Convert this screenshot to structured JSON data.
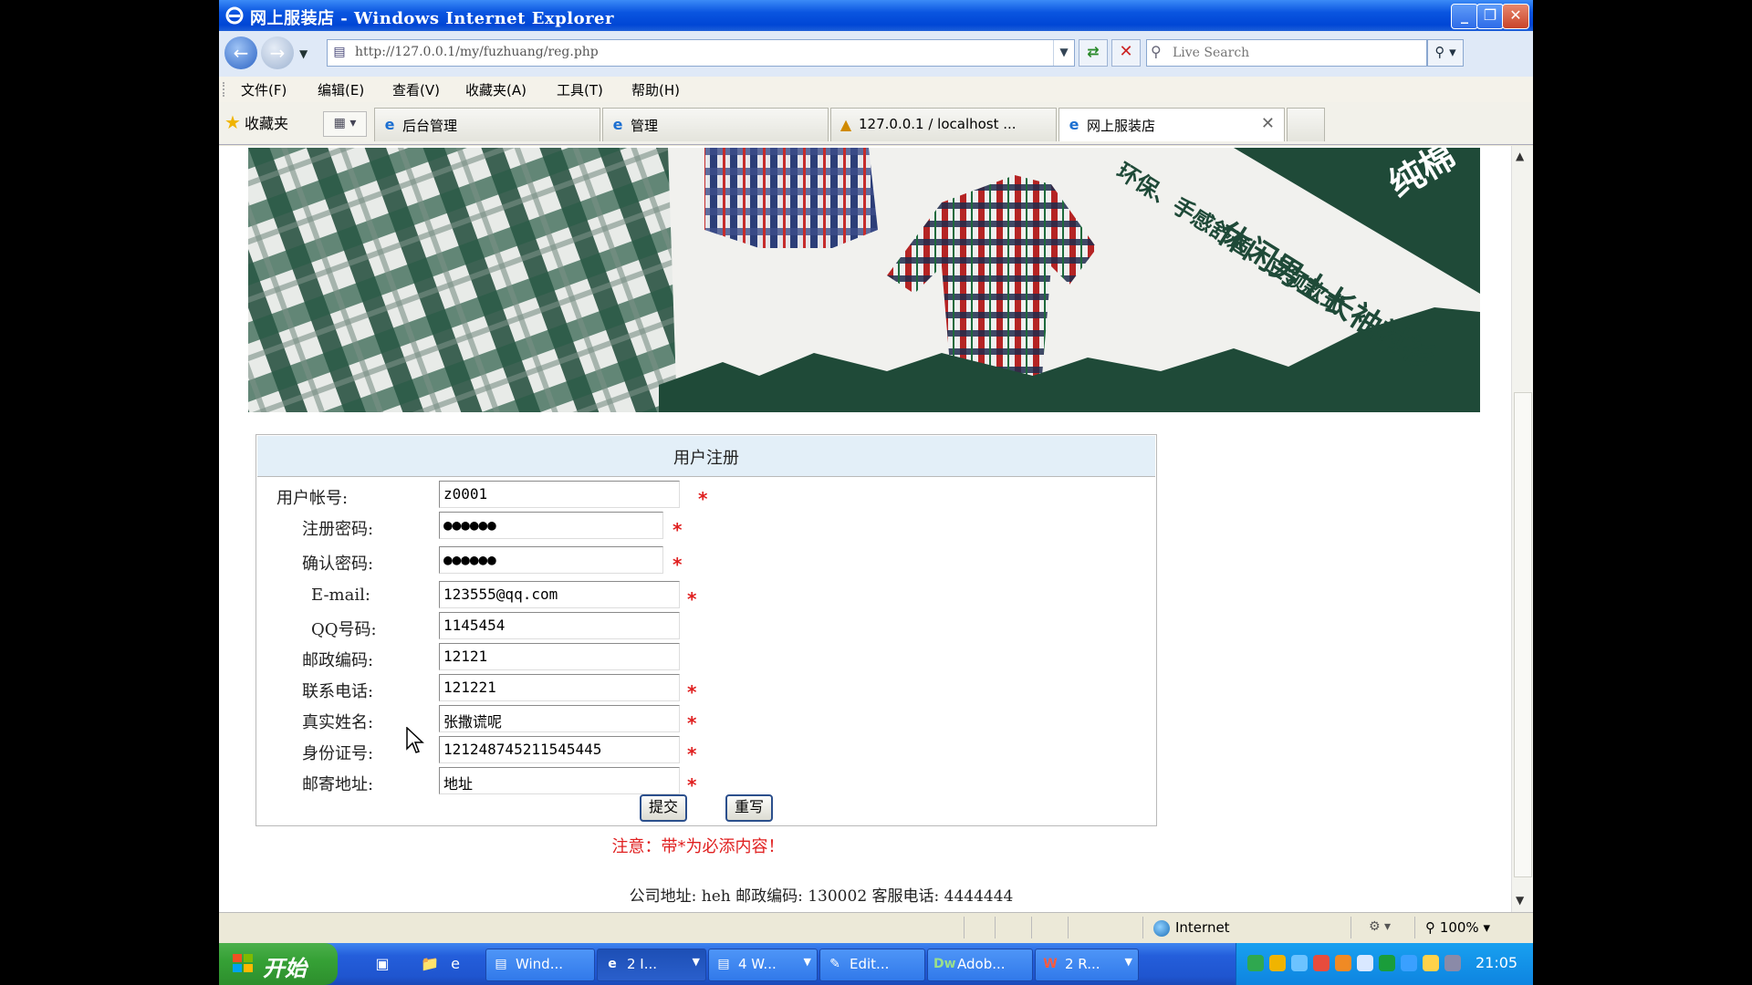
{
  "window": {
    "title": "网上服装店 - Windows Internet Explorer"
  },
  "toolbar": {
    "url": "http://127.0.0.1/my/fuzhuang/reg.php",
    "search_placeholder": "Live Search"
  },
  "menu": [
    "文件(F)",
    "编辑(E)",
    "查看(V)",
    "收藏夹(A)",
    "工具(T)",
    "帮助(H)"
  ],
  "favorites_label": "收藏夹",
  "tabs": [
    {
      "label": "后台管理",
      "active": false
    },
    {
      "label": "管理",
      "active": false
    },
    {
      "label": "127.0.0.1 / localhost ...",
      "active": false
    },
    {
      "label": "网上服装店",
      "active": true
    }
  ],
  "banner": {
    "slogan": "休闲男士长袖衬衫",
    "tagline": "环保、手感舒适、立领款式",
    "corner_text": "纯棉"
  },
  "form": {
    "title": "用户注册",
    "fields": [
      {
        "label": "用户帐号:",
        "value": "z0001",
        "required": true
      },
      {
        "label": "注册密码:",
        "value": "●●●●●●",
        "required": true
      },
      {
        "label": "确认密码:",
        "value": "●●●●●●",
        "required": true
      },
      {
        "label": "E-mail:",
        "value": "123555@qq.com",
        "required": true
      },
      {
        "label": "QQ号码:",
        "value": "1145454",
        "required": false
      },
      {
        "label": "邮政编码:",
        "value": "12121",
        "required": false
      },
      {
        "label": "联系电话:",
        "value": "121221",
        "required": true
      },
      {
        "label": "真实姓名:",
        "value": "张撒谎呢",
        "required": true
      },
      {
        "label": "身份证号:",
        "value": "121248745211545445",
        "required": true
      },
      {
        "label": "邮寄地址:",
        "value": "地址",
        "required": true
      }
    ],
    "required_mark": "*",
    "submit_label": "提交",
    "reset_label": "重写",
    "note": "注意：带*为必添内容！"
  },
  "footer": {
    "text": "公司地址: heh  邮政编码: 130002 客服电话: 4444444"
  },
  "statusbar": {
    "zone": "Internet",
    "zoom": "100%"
  },
  "taskbar": {
    "start_label": "开始",
    "buttons": [
      {
        "label": "Wind...",
        "icon": "computer-icon"
      },
      {
        "label": "2 I...",
        "icon": "ie-icon"
      },
      {
        "label": "4 W...",
        "icon": "folder-icon"
      },
      {
        "label": "Edit...",
        "icon": "editor-icon"
      },
      {
        "label": "Adob...",
        "icon": "dreamweaver-icon"
      },
      {
        "label": "2 R...",
        "icon": "word-icon"
      }
    ],
    "clock": "21:05"
  },
  "colors": {
    "accent_blue": "#0a55e0",
    "required_red": "#e02020",
    "form_header_bg": "#e3eff8",
    "banner_green": "#1f4a38"
  }
}
